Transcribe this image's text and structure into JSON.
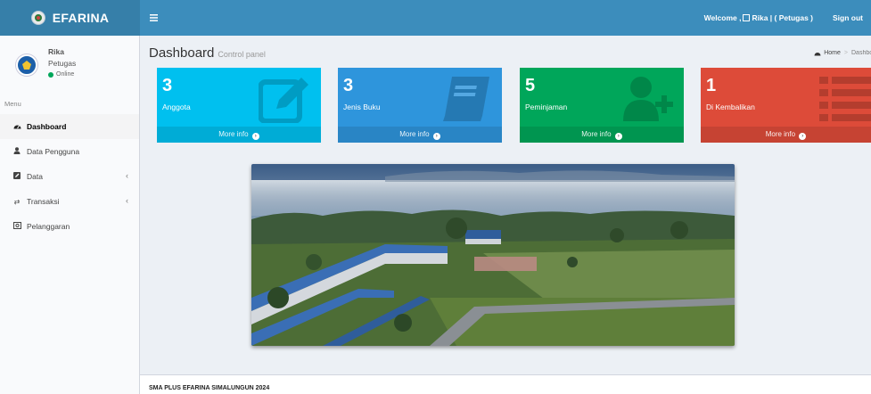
{
  "header": {
    "logo_text": "EFARINA",
    "toggle_icon": "menu-icon",
    "welcome_prefix": "Welcome ,",
    "welcome_user": "Rika | ( Petugas )",
    "signout_label": "Sign out"
  },
  "user": {
    "name": "Rika",
    "role": "Petugas",
    "status": "Online"
  },
  "sidebar": {
    "menu_header": "Menu",
    "items": [
      {
        "label": "Dashboard",
        "icon": "dashboard-icon",
        "active": true
      },
      {
        "label": "Data Pengguna",
        "icon": "user-icon"
      },
      {
        "label": "Data",
        "icon": "edit-icon",
        "has_submenu": true
      },
      {
        "label": "Transaksi",
        "icon": "exchange-icon",
        "has_submenu": true
      },
      {
        "label": "Pelanggaran",
        "icon": "image-icon"
      }
    ]
  },
  "page": {
    "title": "Dashboard",
    "subtitle": "Control panel",
    "breadcrumb_home": "Home",
    "breadcrumb_current": "Dashboard"
  },
  "stats": [
    {
      "value": "3",
      "label": "Anggota",
      "more": "More info",
      "color": "#00c0ef",
      "icon": "edit-icon"
    },
    {
      "value": "3",
      "label": "Jenis Buku",
      "more": "More info",
      "color": "#2e95dc",
      "icon": "book-icon"
    },
    {
      "value": "5",
      "label": "Peminjaman",
      "more": "More info",
      "color": "#00a65a",
      "icon": "user-plus-icon"
    },
    {
      "value": "1",
      "label": "Di Kembalikan",
      "more": "More info",
      "color": "#dd4b39",
      "icon": "list-icon"
    }
  ],
  "footer": {
    "text": "SMA PLUS EFARINA SIMALUNGUN 2024"
  }
}
